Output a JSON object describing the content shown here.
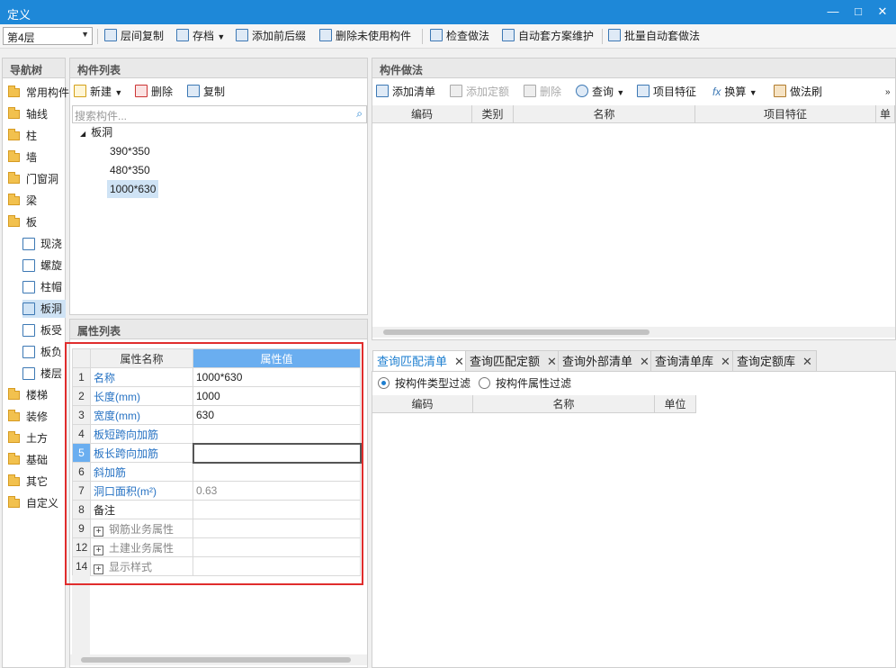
{
  "window": {
    "title": "定义",
    "minimize": "—",
    "maximize": "□",
    "close": "✕"
  },
  "toolbar": {
    "floor": "第4层",
    "items": [
      "层间复制",
      "存档",
      "添加前后缀",
      "删除未使用构件",
      "检查做法",
      "自动套方案维护",
      "批量自动套做法"
    ]
  },
  "nav": {
    "title": "导航树",
    "items": [
      "常用构件",
      "轴线",
      "柱",
      "墙",
      "门窗洞",
      "梁",
      "板"
    ],
    "sub_items": [
      "现浇",
      "螺旋",
      "柱帽",
      "板洞",
      "板受",
      "板负",
      "楼层"
    ],
    "items_after": [
      "楼梯",
      "装修",
      "土方",
      "基础",
      "其它",
      "自定义"
    ]
  },
  "component_list": {
    "title": "构件列表",
    "new": "新建",
    "delete": "删除",
    "copy": "复制",
    "search_placeholder": "搜索构件...",
    "group": "板洞",
    "items": [
      "390*350",
      "480*350",
      "1000*630"
    ]
  },
  "properties": {
    "title": "属性列表",
    "col_name": "属性名称",
    "col_value": "属性值",
    "rows": [
      {
        "num": "1",
        "name": "名称",
        "value": "1000*630"
      },
      {
        "num": "2",
        "name": "长度(mm)",
        "value": "1000"
      },
      {
        "num": "3",
        "name": "宽度(mm)",
        "value": "630"
      },
      {
        "num": "4",
        "name": "板短跨向加筋",
        "value": ""
      },
      {
        "num": "5",
        "name": "板长跨向加筋",
        "value": ""
      },
      {
        "num": "6",
        "name": "斜加筋",
        "value": ""
      },
      {
        "num": "7",
        "name": "洞口面积(m²)",
        "value": "0.63"
      },
      {
        "num": "8",
        "name": "备注",
        "value": ""
      },
      {
        "num": "9",
        "name": "钢筋业务属性",
        "value": ""
      },
      {
        "num": "12",
        "name": "土建业务属性",
        "value": ""
      },
      {
        "num": "14",
        "name": "显示样式",
        "value": ""
      }
    ]
  },
  "method": {
    "title": "构件做法",
    "buttons": [
      "添加清单",
      "添加定额",
      "删除",
      "查询",
      "项目特征",
      "换算",
      "做法刷"
    ],
    "columns": [
      "编码",
      "类别",
      "名称",
      "项目特征",
      "单"
    ]
  },
  "query": {
    "tabs": [
      "查询匹配清单",
      "查询匹配定额",
      "查询外部清单",
      "查询清单库",
      "查询定额库"
    ],
    "filter_type": "按构件类型过滤",
    "filter_attr": "按构件属性过滤",
    "columns": [
      "编码",
      "名称",
      "单位"
    ]
  }
}
